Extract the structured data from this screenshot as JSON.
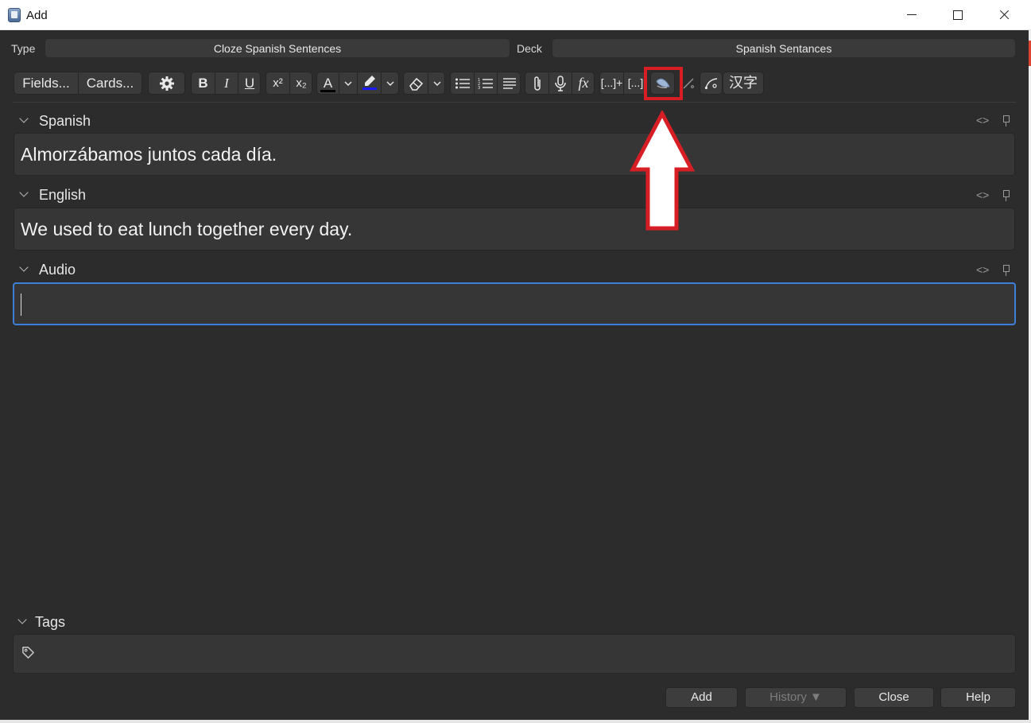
{
  "window": {
    "title": "Add"
  },
  "type_row": {
    "type_label": "Type",
    "type_value": "Cloze Spanish Sentences",
    "deck_label": "Deck",
    "deck_value": "Spanish Sentances"
  },
  "toolbar": {
    "fields_label": "Fields...",
    "cards_label": "Cards...",
    "bold": "B",
    "italic": "I",
    "underline": "U",
    "superscript": "x²",
    "subscript": "x₂",
    "text_color_letter": "A",
    "text_color": "#000000",
    "highlight_color": "#1a1aff",
    "mathjax": "fx",
    "cloze": "[...]+",
    "cloze2": "[...]",
    "chinese": "汉字"
  },
  "fields": [
    {
      "name": "Spanish",
      "value": "Almorzábamos juntos cada día."
    },
    {
      "name": "English",
      "value": "We used to eat lunch together every day."
    },
    {
      "name": "Audio",
      "value": ""
    }
  ],
  "field_html_toggle": "<>",
  "tags": {
    "label": "Tags"
  },
  "buttons": {
    "add": "Add",
    "history": "History ▼",
    "close": "Close",
    "help": "Help"
  },
  "colors": {
    "background": "#2c2c2c",
    "focus": "#3d7fd6",
    "annotation": "#d81e25"
  }
}
